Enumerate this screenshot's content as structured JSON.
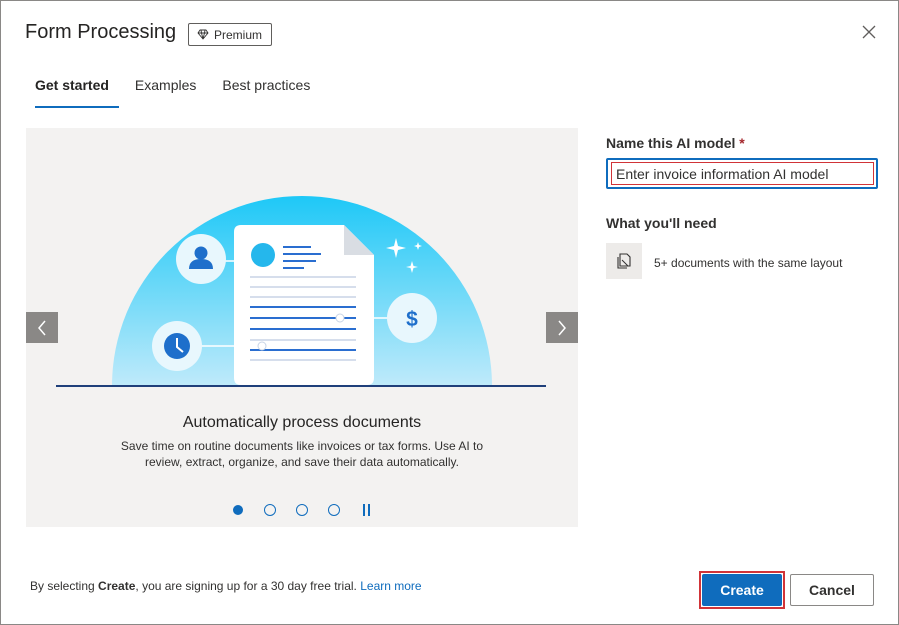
{
  "dialog": {
    "title": "Form Processing",
    "badge": {
      "label": "Premium",
      "icon": "diamond-icon"
    },
    "close_icon": "close-icon"
  },
  "tabs": [
    {
      "label": "Get started",
      "active": true
    },
    {
      "label": "Examples",
      "active": false
    },
    {
      "label": "Best practices",
      "active": false
    }
  ],
  "carousel": {
    "slide_title": "Automatically process documents",
    "slide_description": "Save time on routine documents like invoices or tax forms. Use AI to review, extract, organize, and save their data automatically.",
    "dollar_symbol": "$",
    "current_slide": 1,
    "slide_count": 4
  },
  "form": {
    "name_label": "Name this AI model",
    "required_marker": "*",
    "name_value": "Enter invoice information AI model"
  },
  "needs": {
    "title": "What you'll need",
    "items": [
      {
        "icon": "documents-icon",
        "text": "5+ documents with the same layout"
      }
    ]
  },
  "footer": {
    "note_prefix": "By selecting ",
    "note_bold": "Create",
    "note_suffix": ", you are signing up for a 30 day free trial.",
    "link": "Learn more",
    "create_label": "Create",
    "cancel_label": "Cancel"
  },
  "colors": {
    "accent": "#0f6cbd",
    "focus_outline": "#d13438",
    "carousel_bg": "#f3f2f1"
  }
}
